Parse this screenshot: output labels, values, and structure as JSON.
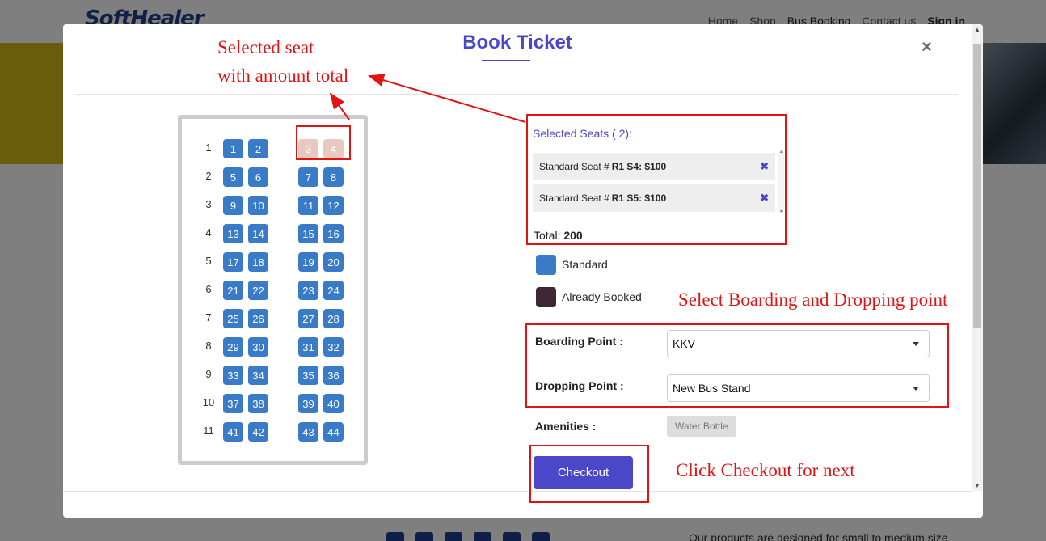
{
  "background": {
    "logo": "SoftHealer",
    "nav": [
      "Home",
      "Shop",
      "Bus Booking",
      "Contact us",
      "Sign in"
    ],
    "footer_text": "Our products are designed for small to medium size"
  },
  "modal": {
    "title": "Book Ticket",
    "close": "×"
  },
  "seat_map": {
    "rows": [
      {
        "row": "1",
        "seats": [
          "1",
          "2",
          "3",
          "4"
        ]
      },
      {
        "row": "2",
        "seats": [
          "5",
          "6",
          "7",
          "8"
        ]
      },
      {
        "row": "3",
        "seats": [
          "9",
          "10",
          "11",
          "12"
        ]
      },
      {
        "row": "4",
        "seats": [
          "13",
          "14",
          "15",
          "16"
        ]
      },
      {
        "row": "5",
        "seats": [
          "17",
          "18",
          "19",
          "20"
        ]
      },
      {
        "row": "6",
        "seats": [
          "21",
          "22",
          "23",
          "24"
        ]
      },
      {
        "row": "7",
        "seats": [
          "25",
          "26",
          "27",
          "28"
        ]
      },
      {
        "row": "8",
        "seats": [
          "29",
          "30",
          "31",
          "32"
        ]
      },
      {
        "row": "9",
        "seats": [
          "33",
          "34",
          "35",
          "36"
        ]
      },
      {
        "row": "10",
        "seats": [
          "37",
          "38",
          "39",
          "40"
        ]
      },
      {
        "row": "11",
        "seats": [
          "41",
          "42",
          "43",
          "44"
        ]
      }
    ],
    "selected": [
      "3",
      "4"
    ],
    "colors": {
      "standard": "#3a7bc8",
      "selected": "#e8c9c0",
      "booked": "#3e2633"
    }
  },
  "selection": {
    "title": "Selected Seats ( 2):",
    "items": [
      {
        "type": "Standard Seat # ",
        "detail": "R1 S4: $100",
        "remove": "✖"
      },
      {
        "type": "Standard Seat # ",
        "detail": "R1 S5: $100",
        "remove": "✖"
      }
    ],
    "total_label": "Total:",
    "total_value": "200"
  },
  "legend": {
    "standard": "Standard",
    "booked": "Already Booked"
  },
  "form": {
    "boarding_label": "Boarding Point :",
    "boarding_value": "KKV",
    "dropping_label": "Dropping Point :",
    "dropping_value": "New Bus Stand",
    "amenities_label": "Amenities :",
    "amenity": "Water Bottle",
    "checkout": "Checkout"
  },
  "annotations": {
    "selected_line1": "Selected seat",
    "selected_line2": "with amount total",
    "boarding": "Select Boarding and Dropping point",
    "checkout": "Click Checkout for next"
  }
}
